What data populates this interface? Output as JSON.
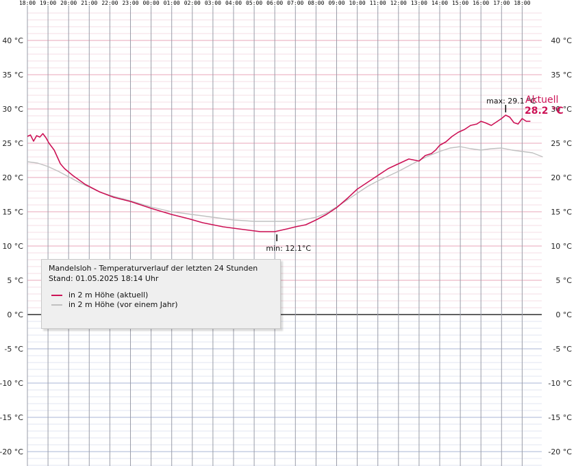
{
  "chart_data": {
    "type": "line",
    "title": "Mandelsloh - Temperaturverlauf der letzten 24 Stunden",
    "subtitle": "Stand: 01.05.2025 18:14 Uhr",
    "y_unit": "°C",
    "ylim": [
      -22,
      45
    ],
    "y_ticks": [
      -20,
      -15,
      -10,
      -5,
      0,
      5,
      10,
      15,
      20,
      25,
      30,
      35,
      40
    ],
    "y_tick_labels": [
      "-20 °C",
      "-15 °C",
      "-10 °C",
      "-5 °C",
      "0 °C",
      "5 °C",
      "10 °C",
      "15 °C",
      "20 °C",
      "25 °C",
      "30 °C",
      "35 °C",
      "40 °C"
    ],
    "x_tick_labels": [
      "18:00",
      "19:00",
      "20:00",
      "21:00",
      "22:00",
      "23:00",
      "00:00",
      "01:00",
      "02:00",
      "03:00",
      "04:00",
      "05:00",
      "06:00",
      "07:00",
      "08:00",
      "09:00",
      "10:00",
      "11:00",
      "12:00",
      "13:00",
      "14:00",
      "15:00",
      "16:00",
      "17:00",
      "18:00"
    ],
    "xlim_hours": [
      0,
      25.5
    ],
    "grid": true,
    "series": [
      {
        "name": "in 2 m Höhe (aktuell)",
        "color": "#cc1155",
        "x": [
          0.0,
          0.15,
          0.3,
          0.45,
          0.6,
          0.75,
          0.9,
          1.05,
          1.3,
          1.6,
          1.8,
          2.2,
          2.8,
          3.5,
          4.2,
          5.0,
          6.0,
          7.0,
          7.8,
          8.5,
          9.5,
          10.5,
          11.3,
          11.8,
          12.0,
          12.3,
          12.6,
          13.0,
          13.5,
          14.0,
          14.5,
          15.0,
          15.5,
          16.0,
          16.5,
          17.0,
          17.5,
          18.0,
          18.5,
          19.0,
          19.3,
          19.6,
          19.8,
          20.0,
          20.3,
          20.6,
          20.9,
          21.2,
          21.5,
          21.8,
          22.0,
          22.2,
          22.5,
          22.8,
          23.0,
          23.2,
          23.4,
          23.6,
          23.8,
          24.0,
          24.2,
          24.4
        ],
        "y": [
          26.0,
          26.2,
          25.3,
          26.1,
          25.9,
          26.4,
          25.8,
          25.0,
          24.0,
          22.0,
          21.3,
          20.3,
          19.0,
          17.9,
          17.1,
          16.5,
          15.5,
          14.6,
          14.0,
          13.4,
          12.8,
          12.4,
          12.1,
          12.1,
          12.1,
          12.3,
          12.5,
          12.8,
          13.1,
          13.8,
          14.6,
          15.6,
          16.9,
          18.3,
          19.3,
          20.3,
          21.3,
          22.0,
          22.7,
          22.4,
          23.2,
          23.5,
          24.0,
          24.7,
          25.2,
          26.0,
          26.6,
          27.0,
          27.6,
          27.8,
          28.2,
          28.0,
          27.6,
          28.2,
          28.6,
          29.1,
          28.8,
          28.0,
          27.8,
          28.6,
          28.2,
          28.2
        ]
      },
      {
        "name": "in 2 m Höhe (vor einem Jahr)",
        "color": "#c0c0c0",
        "x": [
          0.0,
          0.5,
          1.0,
          1.5,
          2.0,
          2.5,
          3.0,
          3.5,
          4.0,
          5.0,
          6.0,
          7.0,
          8.0,
          9.0,
          10.0,
          11.0,
          12.0,
          13.0,
          14.0,
          14.5,
          15.0,
          15.5,
          16.0,
          16.5,
          17.0,
          17.5,
          18.0,
          18.5,
          19.0,
          19.5,
          20.0,
          20.5,
          21.0,
          21.5,
          22.0,
          22.5,
          23.0,
          23.5,
          24.0,
          24.5,
          25.0
        ],
        "y": [
          22.3,
          22.1,
          21.6,
          20.9,
          20.1,
          19.3,
          18.6,
          17.9,
          17.4,
          16.6,
          15.7,
          15.0,
          14.6,
          14.2,
          13.8,
          13.6,
          13.6,
          13.6,
          14.2,
          14.8,
          15.7,
          16.7,
          17.7,
          18.7,
          19.5,
          20.2,
          20.9,
          21.7,
          22.5,
          23.2,
          23.8,
          24.3,
          24.5,
          24.2,
          24.0,
          24.2,
          24.3,
          24.0,
          23.8,
          23.6,
          23.0
        ]
      }
    ],
    "annotations": {
      "max_label": "max: 29.1 °C",
      "max_point": [
        23.2,
        29.1
      ],
      "min_label": "min: 12.1°C",
      "min_point": [
        12.1,
        12.1
      ],
      "current_label": "Aktuell",
      "current_value": "28.2 °C"
    },
    "legend_position": "bottom-left"
  }
}
